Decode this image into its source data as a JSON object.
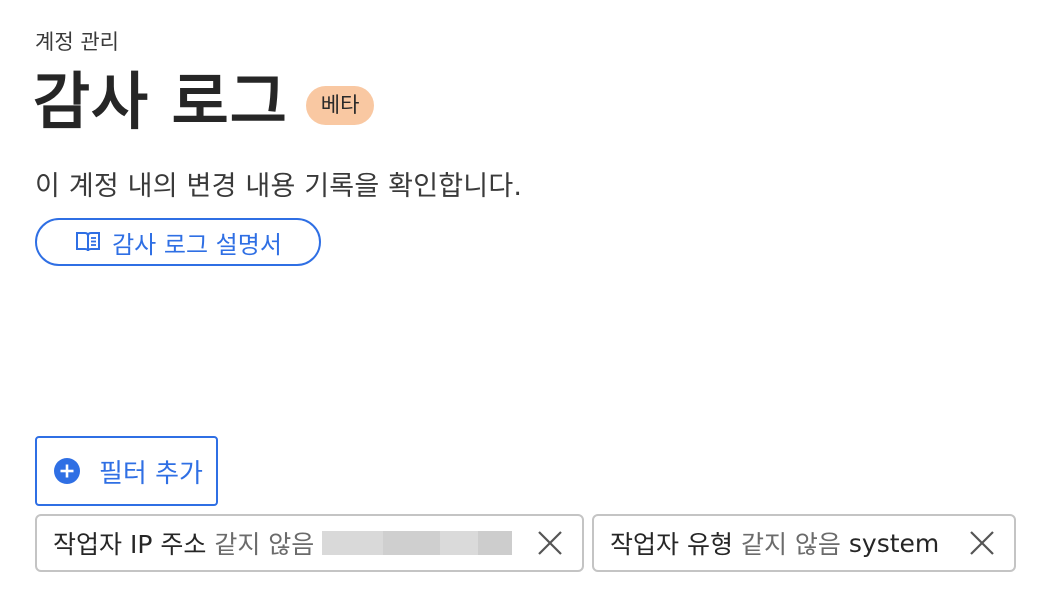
{
  "breadcrumb": "계정 관리",
  "page": {
    "title": "감사 로그",
    "badge": "베타",
    "description": "이 계정 내의 변경 내용 기록을 확인합니다."
  },
  "guide_link": {
    "label": "감사 로그 설명서",
    "icon": "book-icon"
  },
  "add_filter": {
    "label": "필터 추가",
    "icon": "plus-circle-icon"
  },
  "filters": [
    {
      "field": "작업자 IP 주소",
      "operator": "같지 않음",
      "value": "",
      "value_redacted": true
    },
    {
      "field": "작업자 유형",
      "operator": "같지 않음",
      "value": "system",
      "value_redacted": false
    }
  ],
  "colors": {
    "accent": "#2f6fe4",
    "badge_bg": "#f9c8a2",
    "chip_border": "#c4c4c4"
  }
}
